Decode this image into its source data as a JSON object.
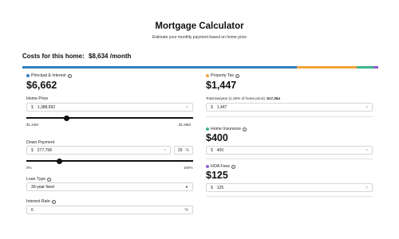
{
  "header": {
    "title": "Mortgage Calculator",
    "subtitle": "Estimate your monthly payment based on home price"
  },
  "summary": {
    "label": "Costs for this home:",
    "amount": "$8,634",
    "period": "/month"
  },
  "breakdown_bar": {
    "segments": [
      {
        "name": "principal-interest",
        "color": "#2f7fc1",
        "fraction": 0.772
      },
      {
        "name": "property-tax",
        "color": "#f2a33a",
        "fraction": 0.168
      },
      {
        "name": "home-insurance",
        "color": "#3fb58a",
        "fraction": 0.046
      },
      {
        "name": "hoa-fees",
        "color": "#8e5fd0",
        "fraction": 0.014
      }
    ]
  },
  "principal": {
    "label": "Principal & Interest",
    "amount": "$6,662",
    "color": "#2f7fc1",
    "info_icon": "info-icon"
  },
  "home_price": {
    "label": "Home Price",
    "prefix": "$",
    "value": "1,388,992",
    "clear": "×",
    "slider_min": "$1.24M",
    "slider_max": "$1.86M",
    "slider_fraction": 0.24
  },
  "down_payment": {
    "label": "Down Payment",
    "prefix": "$",
    "value": "277,798",
    "clear": "×",
    "percent": "20",
    "percent_suffix": "%",
    "slider_min": "0%",
    "slider_max": "100%",
    "slider_fraction": 0.2
  },
  "loan_type": {
    "label": "Loan Type",
    "value": "30-year fixed",
    "info_icon": "info-icon"
  },
  "interest_rate": {
    "label": "Interest Rate",
    "value": "6",
    "suffix": "%",
    "info_icon": "info-icon"
  },
  "property_tax": {
    "label": "Property Tax",
    "amount": "$1,447",
    "color": "#f2a33a",
    "note_prefix": "Total tax/year (1.25% of home price):",
    "note_value": "$17,364",
    "prefix": "$",
    "value": "1,447",
    "clear": "×"
  },
  "home_insurance": {
    "label": "Home Insurance",
    "amount": "$400",
    "color": "#3fb58a",
    "prefix": "$",
    "value": "400",
    "clear": "×"
  },
  "hoa_fees": {
    "label": "HOA Fees",
    "amount": "$125",
    "color": "#8e5fd0",
    "prefix": "$",
    "value": "125",
    "clear": "×"
  }
}
